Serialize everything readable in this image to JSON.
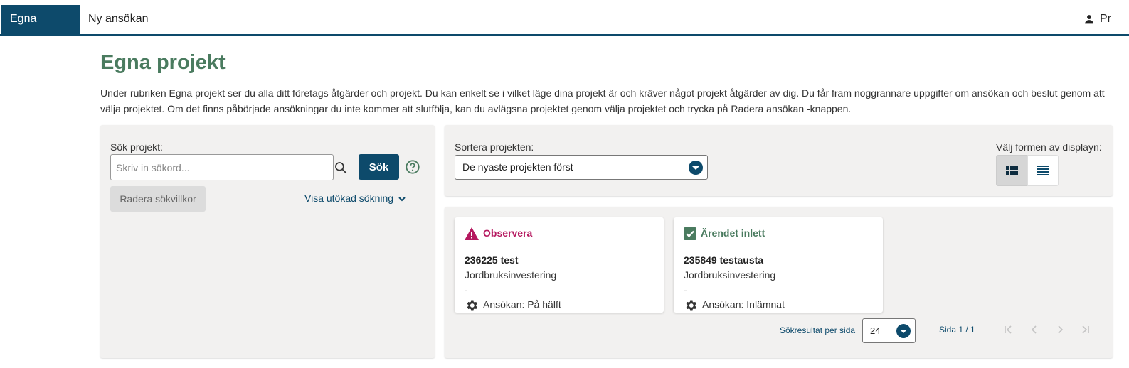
{
  "nav": {
    "tabs": [
      {
        "label": "Egna projekt",
        "active": true
      },
      {
        "label": "Ny ansökan",
        "active": false
      }
    ],
    "profile_label": "Pr"
  },
  "page": {
    "title": "Egna projekt",
    "intro": "Under rubriken Egna projekt ser du alla ditt företags åtgärder och projekt. Du kan enkelt se i vilket läge dina projekt är och kräver något projekt åtgärder av dig. Du får fram noggrannare uppgifter om ansökan och beslut genom att välja projektet. Om det finns påbörjade ansökningar du inte kommer att slutfölja, kan du avlägsna projektet genom välja projektet och trycka på Radera ansökan -knappen."
  },
  "search": {
    "label": "Sök projekt:",
    "placeholder": "Skriv in sökord...",
    "value": "",
    "submit_label": "Sök",
    "clear_label": "Radera sökvillkor",
    "advanced_label": "Visa utökad sökning"
  },
  "sort": {
    "label": "Sortera projekten:",
    "selected": "De nyaste projekten först"
  },
  "view": {
    "label": "Välj formen av displayn:",
    "selected": "grid"
  },
  "results": {
    "cards": [
      {
        "status": "Observera",
        "status_kind": "warning",
        "title": "236225 test",
        "type": "Jordbruksinvestering",
        "dash": "-",
        "application": "Ansökan: På hälft"
      },
      {
        "status": "Ärendet inlett",
        "status_kind": "ok",
        "title": "235849 testausta",
        "type": "Jordbruksinvestering",
        "dash": "-",
        "application": "Ansökan: Inlämnat"
      }
    ],
    "per_page_label": "Sökresultat per sida",
    "per_page_value": "24",
    "page_info": "Sida 1 / 1"
  },
  "colors": {
    "primary": "#0d4a6b",
    "heading_green": "#4a7b5f",
    "warning": "#b5185f",
    "panel_bg": "#f2f1f0"
  }
}
